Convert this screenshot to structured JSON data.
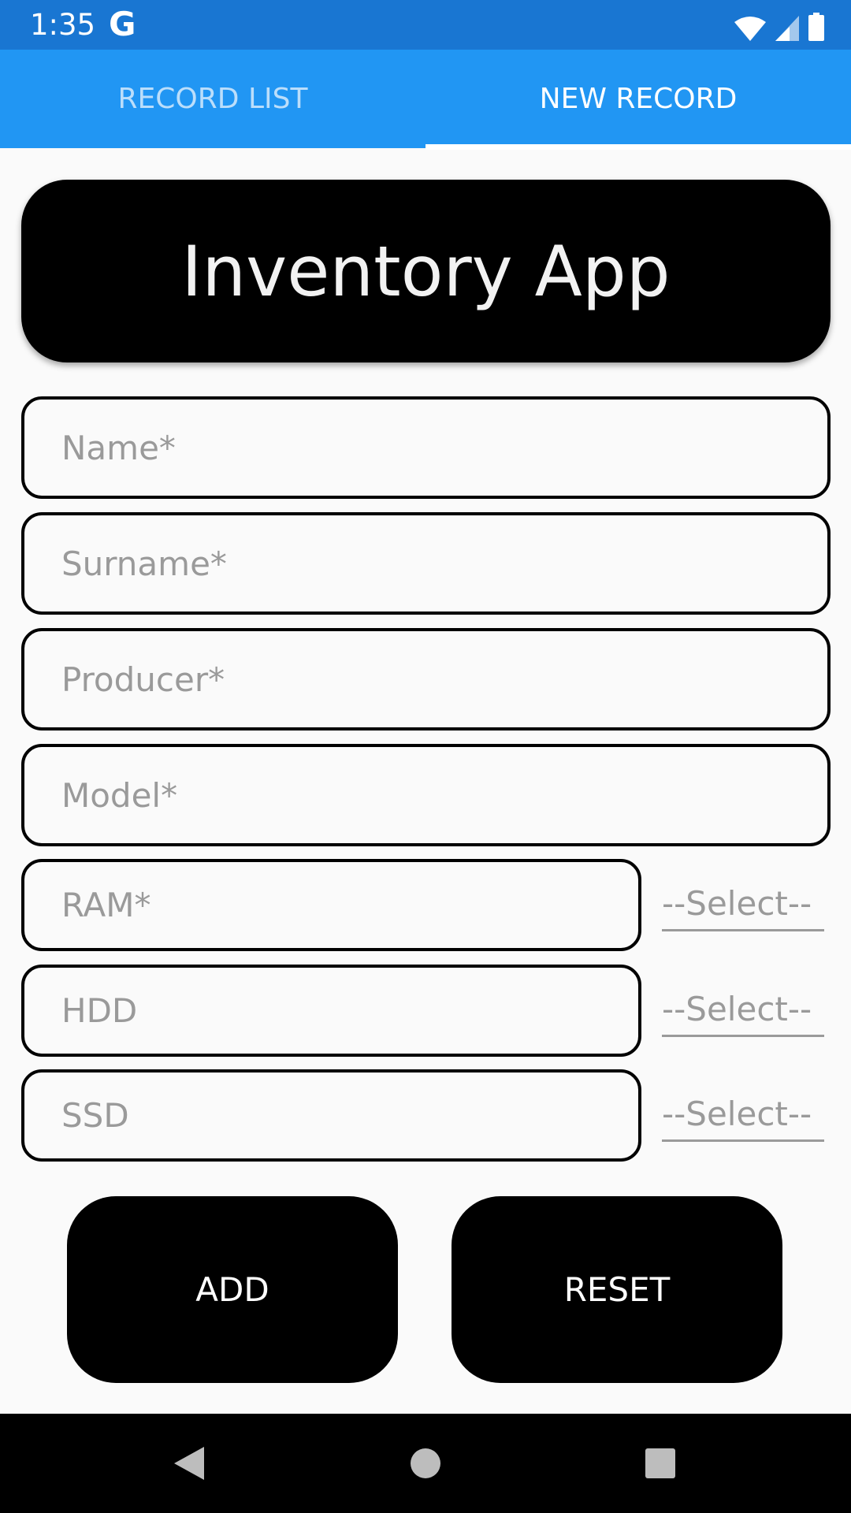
{
  "status_bar": {
    "time": "1:35",
    "app_icon": "G"
  },
  "tabs": [
    {
      "label": "RECORD LIST",
      "selected": false
    },
    {
      "label": "NEW RECORD",
      "selected": true
    }
  ],
  "header": {
    "title": "Inventory App"
  },
  "form": {
    "name": {
      "placeholder": "Name*",
      "value": ""
    },
    "surname": {
      "placeholder": "Surname*",
      "value": ""
    },
    "producer": {
      "placeholder": "Producer*",
      "value": ""
    },
    "model": {
      "placeholder": "Model*",
      "value": ""
    },
    "ram": {
      "placeholder": "RAM*",
      "value": "",
      "select": "--Select--"
    },
    "hdd": {
      "placeholder": "HDD",
      "value": "",
      "select": "--Select--"
    },
    "ssd": {
      "placeholder": "SSD",
      "value": "",
      "select": "--Select--"
    }
  },
  "buttons": {
    "add": "ADD",
    "reset": "RESET"
  },
  "colors": {
    "status_bar": "#1976d2",
    "tab_bar": "#2196f3",
    "tab_unselected": "#bbdefb",
    "card": "#000000",
    "placeholder": "#9a9a9a"
  },
  "icons": {
    "status": [
      "wifi-icon",
      "cell-signal-icon",
      "battery-icon"
    ],
    "nav": [
      "back-icon",
      "home-icon",
      "recents-icon"
    ]
  }
}
